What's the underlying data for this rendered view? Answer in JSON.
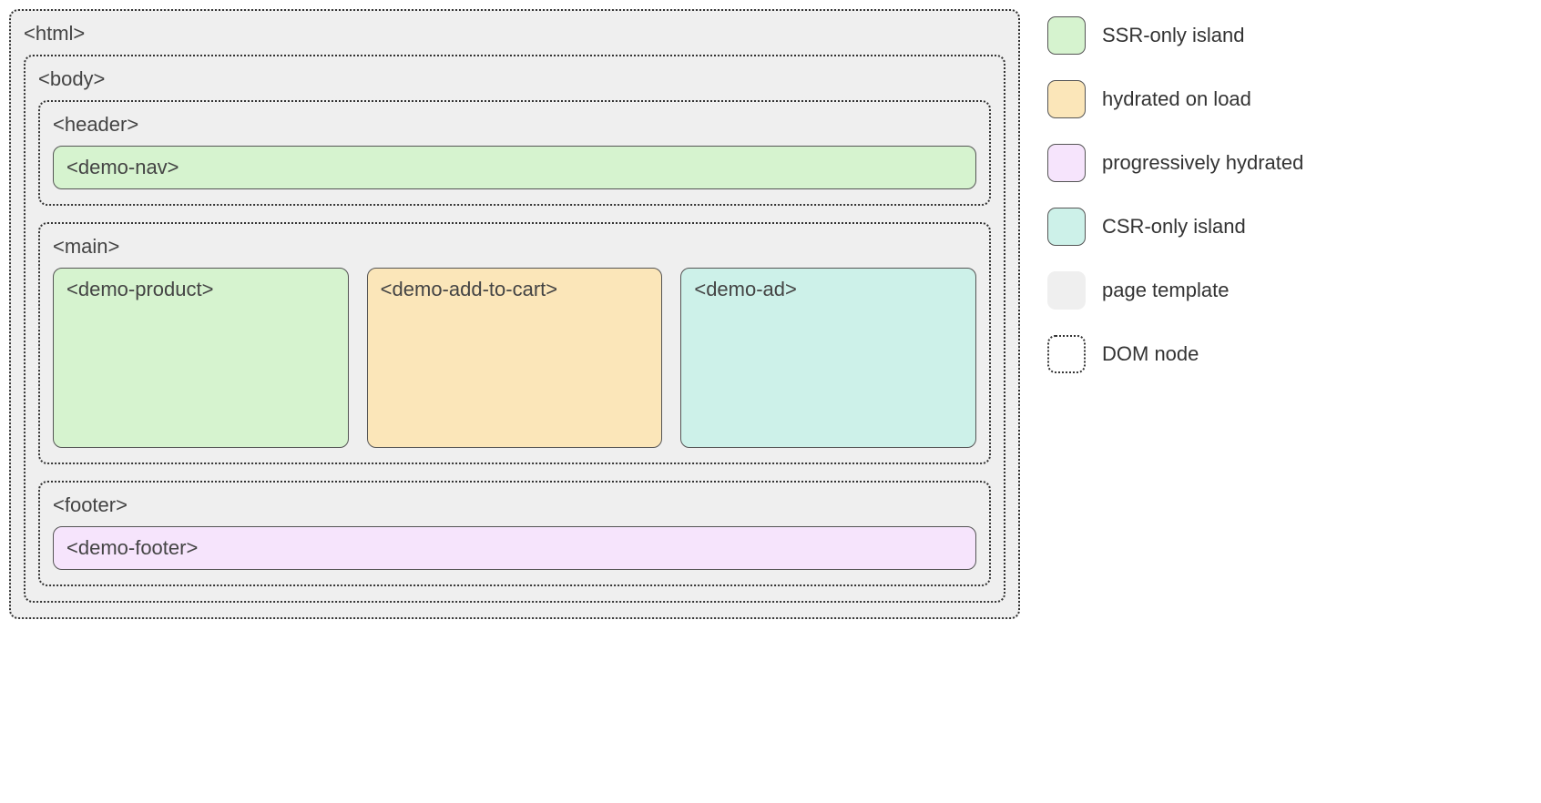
{
  "diagram": {
    "html_label": "<html>",
    "body_label": "<body>",
    "header": {
      "label": "<header>",
      "nav_island": "<demo-nav>"
    },
    "main": {
      "label": "<main>",
      "product_island": "<demo-product>",
      "cart_island": "<demo-add-to-cart>",
      "ad_island": "<demo-ad>"
    },
    "footer": {
      "label": "<footer>",
      "footer_island": "<demo-footer>"
    }
  },
  "legend": {
    "ssr": "SSR-only island",
    "hydrated": "hydrated on load",
    "progressive": "progressively hydrated",
    "csr": "CSR-only island",
    "template": "page template",
    "domnode": "DOM node"
  },
  "colors": {
    "ssr": "#d6f3cf",
    "hydrated": "#fbe6b9",
    "progressive": "#f6e4fc",
    "csr": "#cdf1e9",
    "template": "#efefef"
  }
}
